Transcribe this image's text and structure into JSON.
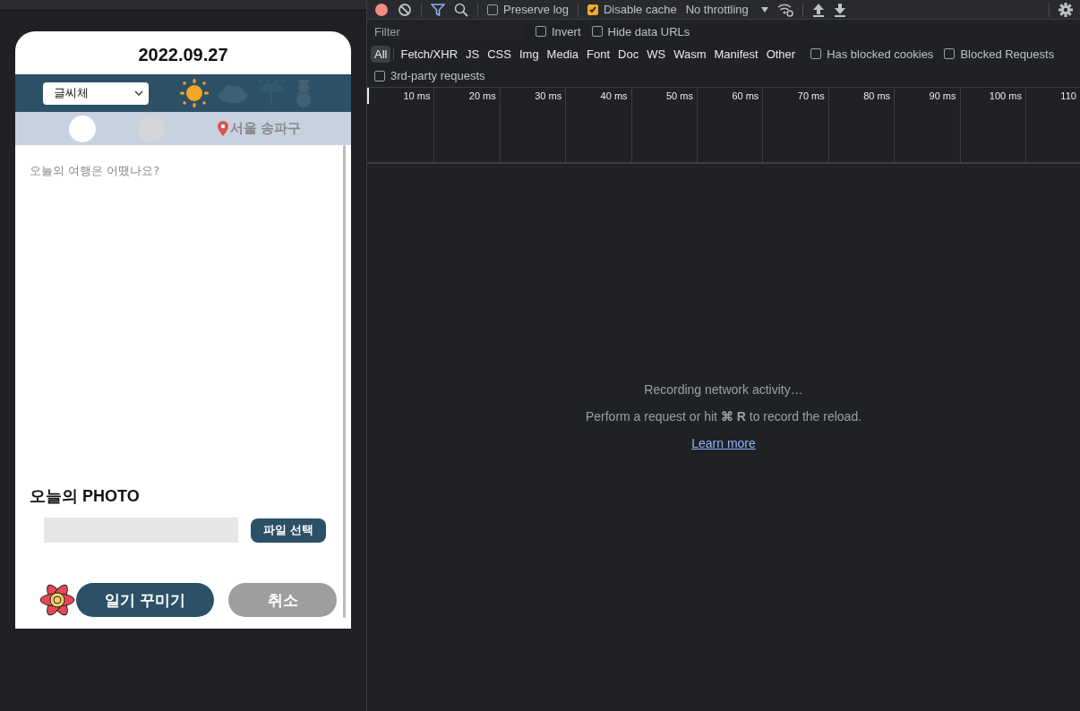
{
  "diary": {
    "date": "2022.09.27",
    "font_select": {
      "value": "글씨체"
    },
    "weather": [
      {
        "kind": "sun",
        "selected": true
      },
      {
        "kind": "cloud",
        "selected": false
      },
      {
        "kind": "rain",
        "selected": false
      },
      {
        "kind": "snow",
        "selected": false
      }
    ],
    "moods": [
      {
        "selected": true
      },
      {
        "selected": false
      }
    ],
    "location": "서울 송파구",
    "entry": {
      "placeholder": "오늘의 여행은 어땠나요?"
    },
    "photo": {
      "heading": "오늘의 PHOTO",
      "button": "파일 선택"
    },
    "buttons": [
      {
        "kind": "primary",
        "label": "일기 꾸미기"
      },
      {
        "kind": "secondary",
        "label": "취소"
      }
    ]
  },
  "devtools": {
    "toolbar": {
      "checkboxes": [
        {
          "label": "Preserve log",
          "checked": false
        },
        {
          "label": "Disable cache",
          "checked": true
        }
      ],
      "throttling": "No throttling"
    },
    "filter": {
      "placeholder": "Filter",
      "checkboxes": [
        {
          "label": "Invert",
          "checked": false
        },
        {
          "label": "Hide data URLs",
          "checked": false
        }
      ]
    },
    "types": [
      {
        "label": "All",
        "selected": true
      },
      {
        "label": "Fetch/XHR",
        "selected": false
      },
      {
        "label": "JS",
        "selected": false
      },
      {
        "label": "CSS",
        "selected": false
      },
      {
        "label": "Img",
        "selected": false
      },
      {
        "label": "Media",
        "selected": false
      },
      {
        "label": "Font",
        "selected": false
      },
      {
        "label": "Doc",
        "selected": false
      },
      {
        "label": "WS",
        "selected": false
      },
      {
        "label": "Wasm",
        "selected": false
      },
      {
        "label": "Manifest",
        "selected": false
      },
      {
        "label": "Other",
        "selected": false
      }
    ],
    "type_checkboxes": [
      {
        "label": "Has blocked cookies",
        "checked": false
      },
      {
        "label": "Blocked Requests",
        "checked": false
      }
    ],
    "extra_checkboxes": [
      {
        "label": "3rd-party requests",
        "checked": false
      }
    ],
    "timeline": [
      "10 ms",
      "20 ms",
      "30 ms",
      "40 ms",
      "50 ms",
      "60 ms",
      "70 ms",
      "80 ms",
      "90 ms",
      "100 ms",
      "110"
    ],
    "empty": {
      "title": "Recording network activity…",
      "hint": "Perform a request or hit **⌘ R** to record the reload.",
      "link": "Learn more"
    }
  }
}
